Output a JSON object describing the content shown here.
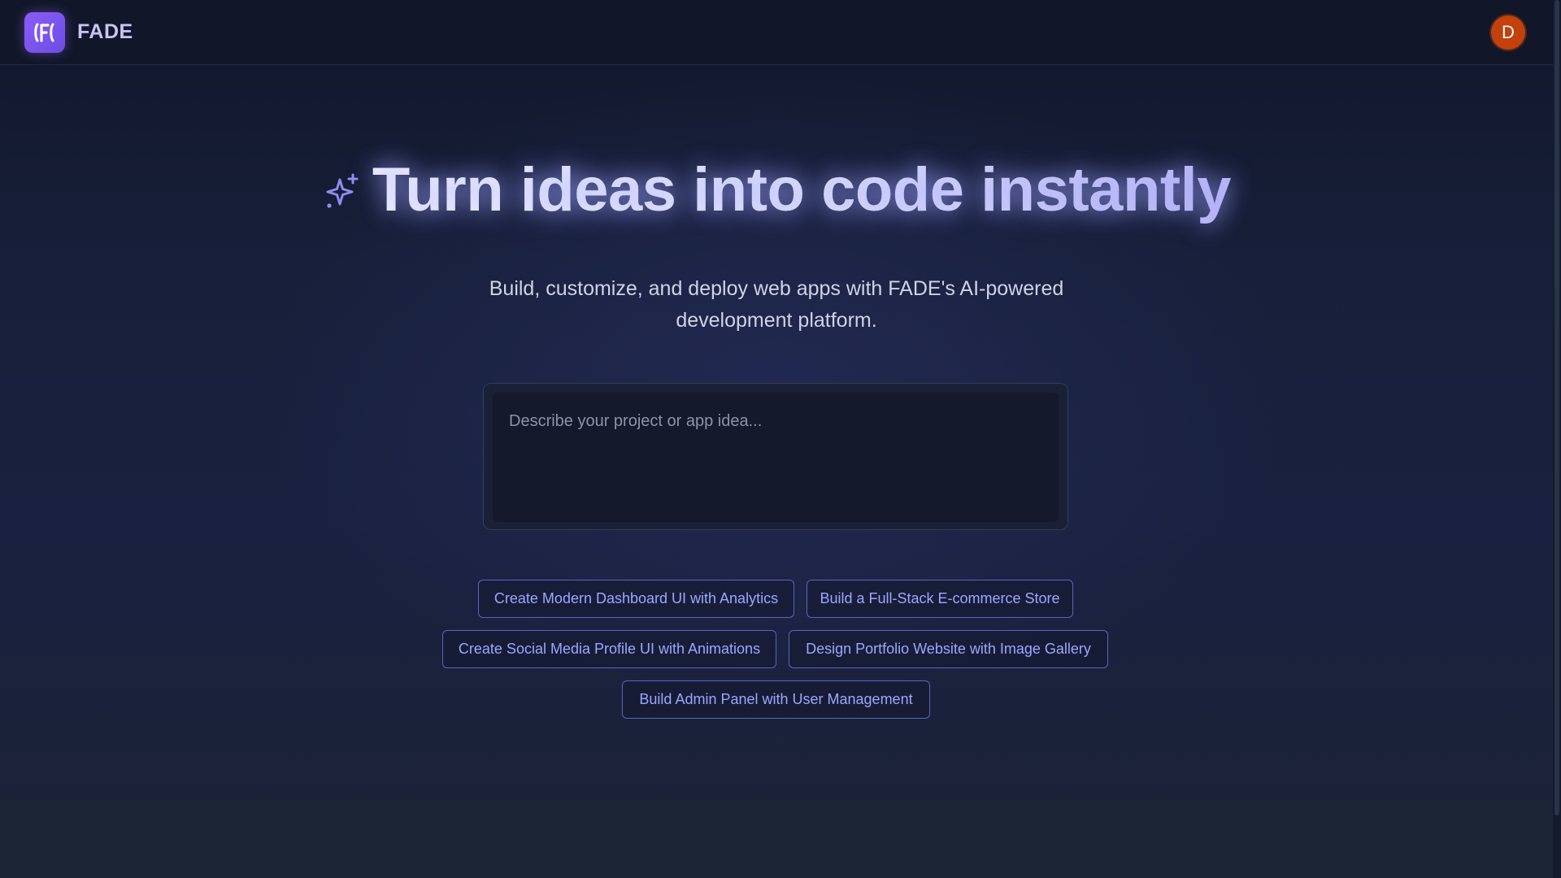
{
  "header": {
    "brand": "FADE",
    "logo_icon": "fade-logo-icon",
    "avatar_initial": "D"
  },
  "hero": {
    "icon": "sparkle-icon",
    "title": "Turn ideas into code instantly",
    "subtitle": "Build, customize, and deploy web apps with FADE's AI-powered development platform."
  },
  "prompt": {
    "placeholder": "Describe your project or app idea...",
    "value": ""
  },
  "suggestions": [
    "Create Modern Dashboard UI with Analytics",
    "Build a Full-Stack E-commerce Store",
    "Create Social Media Profile UI with Animations",
    "Design Portfolio Website with Image Gallery",
    "Build Admin Panel with User Management"
  ],
  "colors": {
    "accent": "#8b5cf6",
    "suggestion_text": "#9ea5ff",
    "avatar_bg": "#c2410c"
  }
}
